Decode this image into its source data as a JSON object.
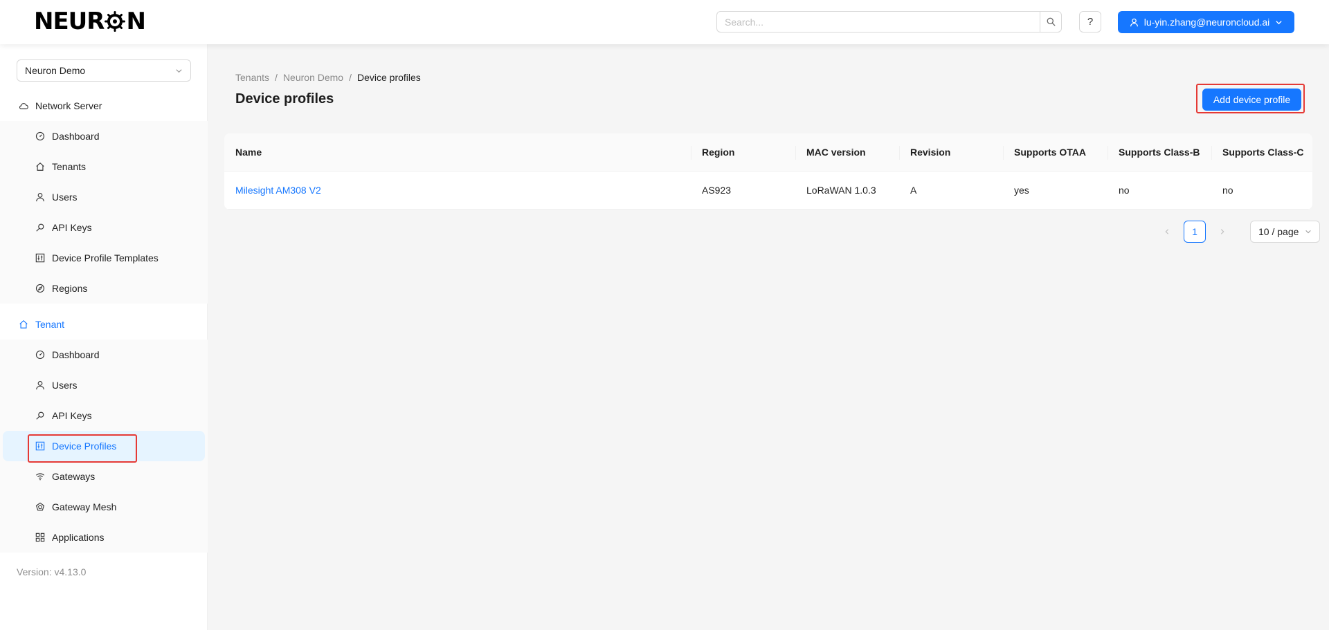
{
  "header": {
    "logo_text_left": "NEUR",
    "logo_text_right": "N",
    "search_placeholder": "Search...",
    "help_label": "?",
    "user_email": "lu-yin.zhang@neuroncloud.ai",
    "accent_color": "#1677ff"
  },
  "sidebar": {
    "tenant_select_value": "Neuron Demo",
    "network_server": {
      "title": "Network Server",
      "icon": "cloud-icon",
      "items": [
        {
          "label": "Dashboard",
          "icon": "dashboard-icon"
        },
        {
          "label": "Tenants",
          "icon": "home-icon"
        },
        {
          "label": "Users",
          "icon": "user-icon"
        },
        {
          "label": "API Keys",
          "icon": "key-icon"
        },
        {
          "label": "Device Profile Templates",
          "icon": "sliders-icon"
        },
        {
          "label": "Regions",
          "icon": "compass-icon"
        }
      ]
    },
    "tenant": {
      "title": "Tenant",
      "icon": "home-icon",
      "items": [
        {
          "label": "Dashboard",
          "icon": "dashboard-icon"
        },
        {
          "label": "Users",
          "icon": "user-icon"
        },
        {
          "label": "API Keys",
          "icon": "key-icon"
        },
        {
          "label": "Device Profiles",
          "icon": "sliders-icon",
          "selected": true
        },
        {
          "label": "Gateways",
          "icon": "wifi-icon"
        },
        {
          "label": "Gateway Mesh",
          "icon": "mesh-icon"
        },
        {
          "label": "Applications",
          "icon": "grid-icon"
        }
      ]
    },
    "version": "Version: v4.13.0"
  },
  "breadcrumb": [
    "Tenants",
    "Neuron Demo",
    "Device profiles"
  ],
  "page_title": "Device profiles",
  "add_button_label": "Add device profile",
  "table": {
    "columns": [
      "Name",
      "Region",
      "MAC version",
      "Revision",
      "Supports OTAA",
      "Supports Class-B",
      "Supports Class-C"
    ],
    "rows": [
      [
        "Milesight AM308 V2",
        "AS923",
        "LoRaWAN 1.0.3",
        "A",
        "yes",
        "no",
        "no"
      ]
    ]
  },
  "pagination": {
    "current_page": "1",
    "page_size": "10 / page"
  },
  "highlight_color": "#e53935"
}
